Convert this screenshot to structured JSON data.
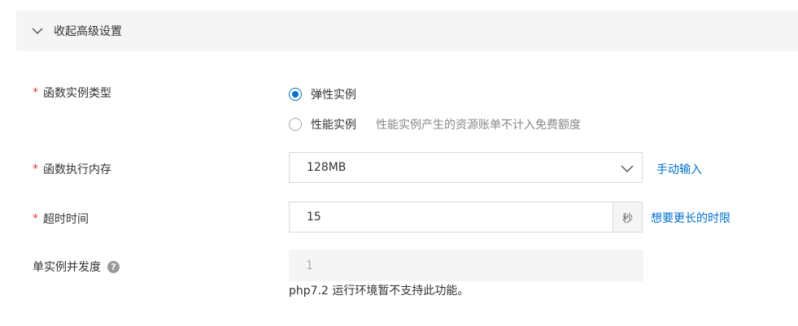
{
  "advanced": {
    "toggle_label": "收起高级设置"
  },
  "instance_type": {
    "required_mark": "*",
    "label": "函数实例类型",
    "options": [
      {
        "label": "弹性实例",
        "checked": true
      },
      {
        "label": "性能实例",
        "checked": false,
        "hint": "性能实例产生的资源账单不计入免费额度"
      }
    ]
  },
  "memory": {
    "required_mark": "*",
    "label": "函数执行内存",
    "value": "128MB",
    "manual_link": "手动输入"
  },
  "timeout": {
    "required_mark": "*",
    "label": "超时时间",
    "value": "15",
    "unit": "秒",
    "longer_link": "想要更长的时限"
  },
  "concurrency": {
    "label": "单实例并发度",
    "help_icon": "?",
    "value": "1",
    "note": "php7.2 运行环境暂不支持此功能。"
  },
  "colors": {
    "accent": "#0070cc",
    "required": "#e0422b",
    "header_bg": "#f5f5f5"
  },
  "icons": {
    "toggle": "chevron-down-icon",
    "select": "chevron-down-icon",
    "help": "question-circle-icon"
  }
}
